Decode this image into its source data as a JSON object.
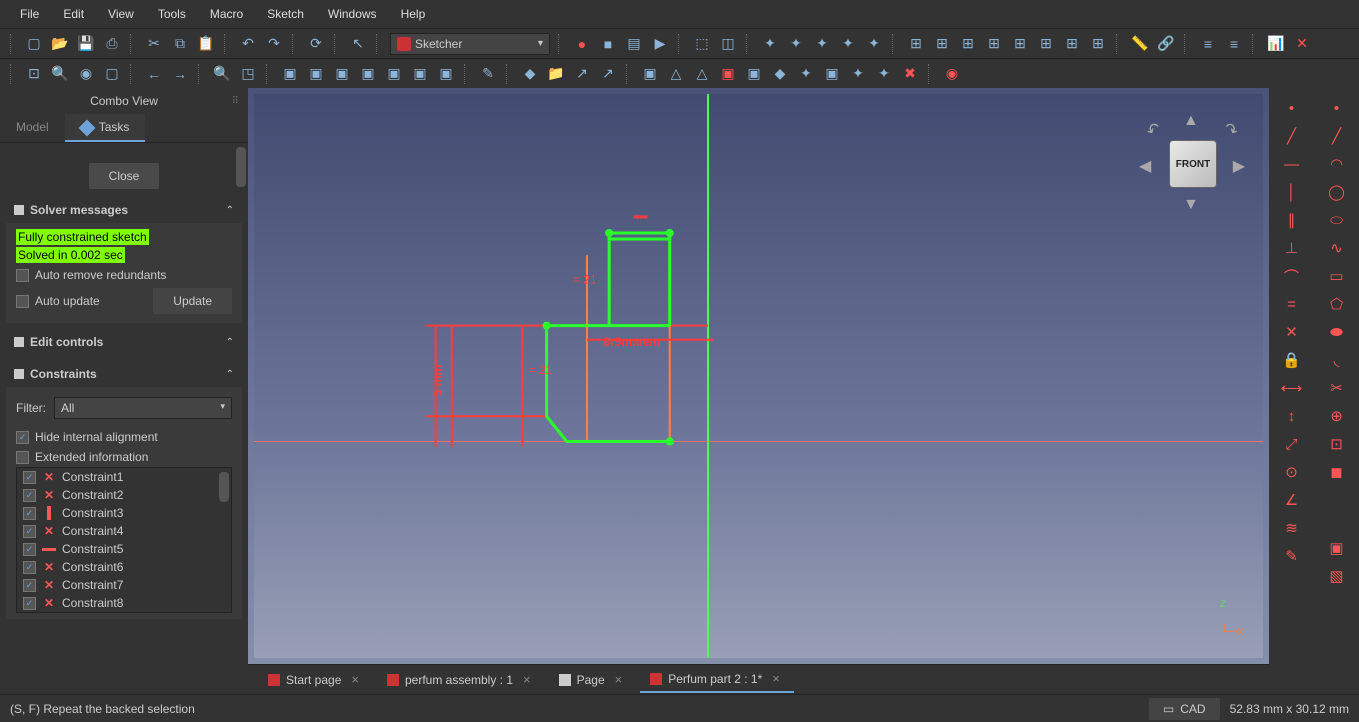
{
  "menu": [
    "File",
    "Edit",
    "View",
    "Tools",
    "Macro",
    "Sketch",
    "Windows",
    "Help"
  ],
  "workbench": "Sketcher",
  "combo_title": "Combo View",
  "tabs": {
    "model": "Model",
    "tasks": "Tasks"
  },
  "close_btn": "Close",
  "solver": {
    "title": "Solver messages",
    "msg1": "Fully constrained sketch",
    "msg2": "Solved in 0.002 sec",
    "auto_remove": "Auto remove redundants",
    "auto_update": "Auto update",
    "update_btn": "Update"
  },
  "edit_controls": "Edit controls",
  "constraints": {
    "title": "Constraints",
    "filter_label": "Filter:",
    "filter_value": "All",
    "hide_internal": "Hide internal alignment",
    "extended_info": "Extended information",
    "items": [
      "Constraint1",
      "Constraint2",
      "Constraint3",
      "Constraint4",
      "Constraint5",
      "Constraint6",
      "Constraint7",
      "Constraint8"
    ]
  },
  "navcube": "FRONT",
  "sketch_labels": {
    "dim1": "5 mm",
    "eq1": "= 21",
    "eq2": "= 21",
    "overlap": "8r5mmem"
  },
  "axis": {
    "z": "z",
    "x": "x"
  },
  "doctabs": [
    {
      "label": "Start page",
      "active": false,
      "icon": "r"
    },
    {
      "label": "perfum assembly : 1",
      "active": false,
      "icon": "r"
    },
    {
      "label": "Page",
      "active": false,
      "icon": "w"
    },
    {
      "label": "Perfum part 2 : 1*",
      "active": true,
      "icon": "r"
    }
  ],
  "status": {
    "left": "(S, F) Repeat the backed selection",
    "cad": "CAD",
    "coords": "52.83 mm x 30.12 mm"
  }
}
